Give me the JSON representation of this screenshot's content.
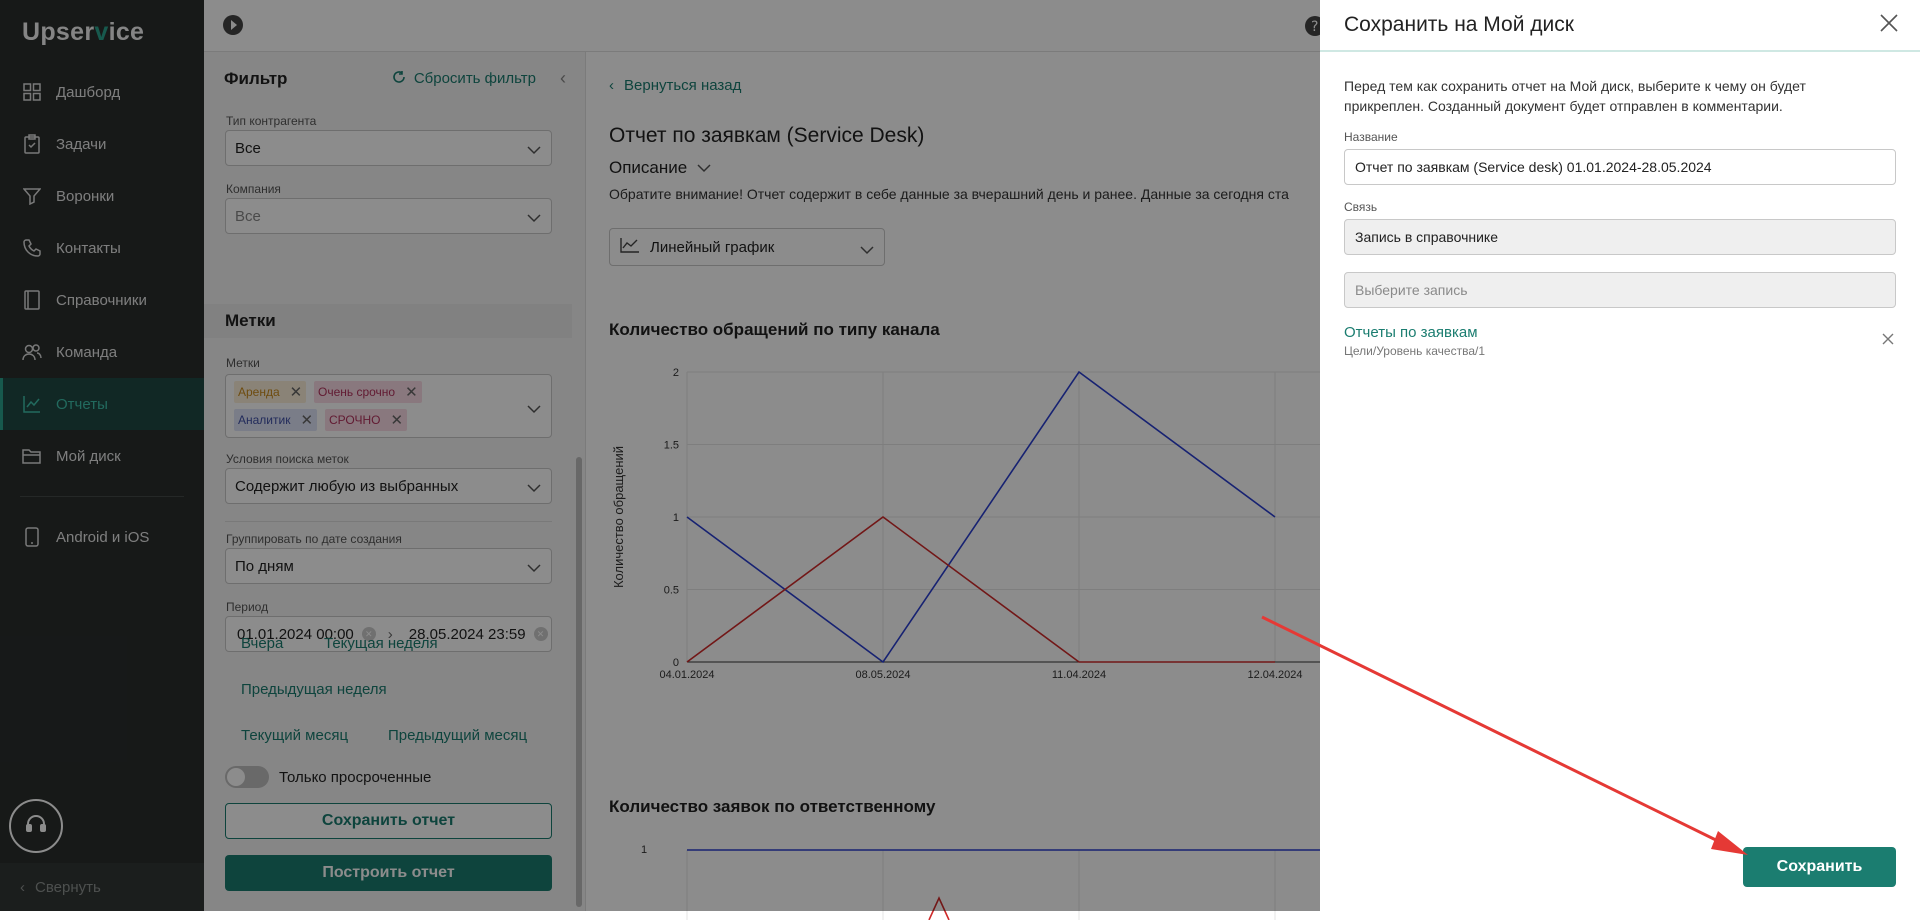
{
  "app": {
    "logo_pre": "Upser",
    "logo_accent": "v",
    "logo_post": "ice"
  },
  "sidebar": {
    "items": [
      {
        "label": "Дашборд",
        "icon": "dashboard-icon"
      },
      {
        "label": "Задачи",
        "icon": "tasks-icon"
      },
      {
        "label": "Воронки",
        "icon": "funnel-icon"
      },
      {
        "label": "Контакты",
        "icon": "phone-icon"
      },
      {
        "label": "Справочники",
        "icon": "book-icon"
      },
      {
        "label": "Команда",
        "icon": "team-icon"
      },
      {
        "label": "Отчеты",
        "icon": "chart-icon",
        "active": true
      },
      {
        "label": "Мой диск",
        "icon": "folder-icon"
      }
    ],
    "extra": {
      "label": "Android и iOS",
      "icon": "mobile-icon"
    },
    "collapse_label": "Свернуть"
  },
  "filter": {
    "title": "Фильтр",
    "reset_label": "Сбросить фильтр",
    "contractor_type": {
      "label": "Тип контрагента",
      "value": "Все"
    },
    "company": {
      "label": "Компания",
      "value": "Все"
    },
    "tags_section": "Метки",
    "tags_label": "Метки",
    "tags": [
      "Аренда",
      "Очень срочно",
      "Аналитик",
      "СРОЧНО"
    ],
    "search_condition": {
      "label": "Условия поиска меток",
      "value": "Содержит любую из выбранных"
    },
    "group_by": {
      "label": "Группировать по дате создания",
      "value": "По дням"
    },
    "period": {
      "label": "Период",
      "from": "01.01.2024 00:00",
      "to": "28.05.2024 23:59"
    },
    "quick": {
      "yesterday": "Вчера",
      "this_week": "Текущая неделя",
      "prev_week": "Предыдущая неделя",
      "this_month": "Текущий месяц",
      "prev_month": "Предыдущий месяц"
    },
    "overdue_label": "Только просроченные",
    "save_report": "Сохранить отчет",
    "build_report": "Построить отчет"
  },
  "main": {
    "back_label": "Вернуться назад",
    "title": "Отчет по заявкам (Service Desk)",
    "description_label": "Описание",
    "note": "Обратите внимание! Отчет содержит в себе данные за вчерашний день и ранее. Данные за сегодня ста",
    "chart_type": "Линейный график",
    "chart1_title": "Количество обращений по типу канала",
    "chart2_title": "Количество заявок по ответственному"
  },
  "chart_data": [
    {
      "type": "line",
      "title": "Количество обращений по типу канала",
      "xlabel": "",
      "ylabel": "Количество обращений",
      "categories": [
        "04.01.2024",
        "08.05.2024",
        "11.04.2024",
        "12.04.2024"
      ],
      "yticks": [
        "0",
        "0.5",
        "1",
        "1.5",
        "2"
      ],
      "ylim": [
        0,
        2
      ],
      "series": [
        {
          "values": [
            1,
            0,
            2,
            1
          ],
          "color": "#2a3fd0"
        },
        {
          "values": [
            0,
            1,
            0,
            0
          ],
          "color": "#cf2a2a"
        }
      ],
      "grid": true
    },
    {
      "type": "line",
      "title": "Количество заявок по ответственному",
      "yticks": [
        "1"
      ],
      "grid": true
    }
  ],
  "dialog": {
    "title": "Сохранить на Мой диск",
    "intro": "Перед тем как сохранить отчет на Мой диск, выберите к чему он будет прикреплен. Созданный документ будет отправлен в комментарии.",
    "name_label": "Название",
    "name_value": "Отчет по заявкам (Service desk) 01.01.2024-28.05.2024",
    "link_label": "Связь",
    "link_value": "Запись в справочнике",
    "record_placeholder": "Выберите запись",
    "linked_title": "Отчеты по заявкам",
    "linked_path": "Цели/Уровень качества/1",
    "save_label": "Сохранить"
  },
  "colors": {
    "accent": "#1b7d70",
    "sidebar_bg": "#2a2e2d",
    "arrow": "#e53935"
  }
}
